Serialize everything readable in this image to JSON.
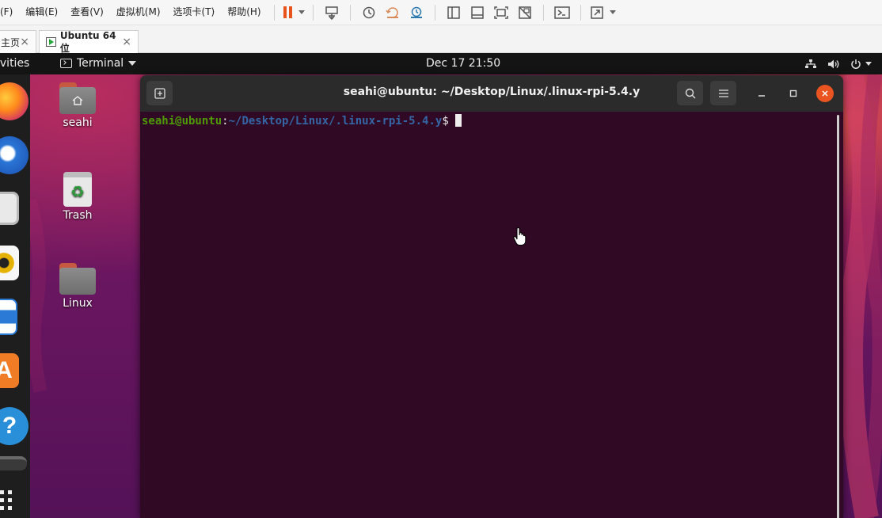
{
  "vmware": {
    "menu": [
      "(F)",
      "编辑(E)",
      "查看(V)",
      "虚拟机(M)",
      "选项卡(T)",
      "帮助(H)"
    ],
    "tabs": [
      {
        "label": "主页",
        "close": "×"
      },
      {
        "label": "Ubuntu 64 位",
        "close": "×"
      }
    ],
    "colors": {
      "pause": "#e8531c",
      "vm_running": "#26a63b"
    }
  },
  "ubuntu": {
    "topbar": {
      "activities": "ivities",
      "app_menu": "Terminal",
      "clock": "Dec 17  21:50"
    },
    "dock_icons": [
      "firefox-icon",
      "thunderbird-icon",
      "files-icon",
      "rhythmbox-icon",
      "libreoffice-writer-icon",
      "ubuntu-software-icon",
      "help-icon",
      "removable-drive-icon",
      "show-applications-icon"
    ],
    "desktop_icons": [
      {
        "label": "seahi",
        "icon": "home-folder-icon"
      },
      {
        "label": "Trash",
        "icon": "trash-icon"
      },
      {
        "label": "Linux",
        "icon": "folder-icon"
      }
    ],
    "terminal": {
      "title": "seahi@ubuntu: ~/Desktop/Linux/.linux-rpi-5.4.y",
      "prompt_user": "seahi@ubuntu",
      "prompt_colon": ":",
      "prompt_path": "~/Desktop/Linux/.linux-rpi-5.4.y",
      "prompt_dollar": "$",
      "colors": {
        "background": "#300a24",
        "user": "#4e9a06",
        "path": "#3465a4",
        "close": "#e95420"
      }
    }
  }
}
